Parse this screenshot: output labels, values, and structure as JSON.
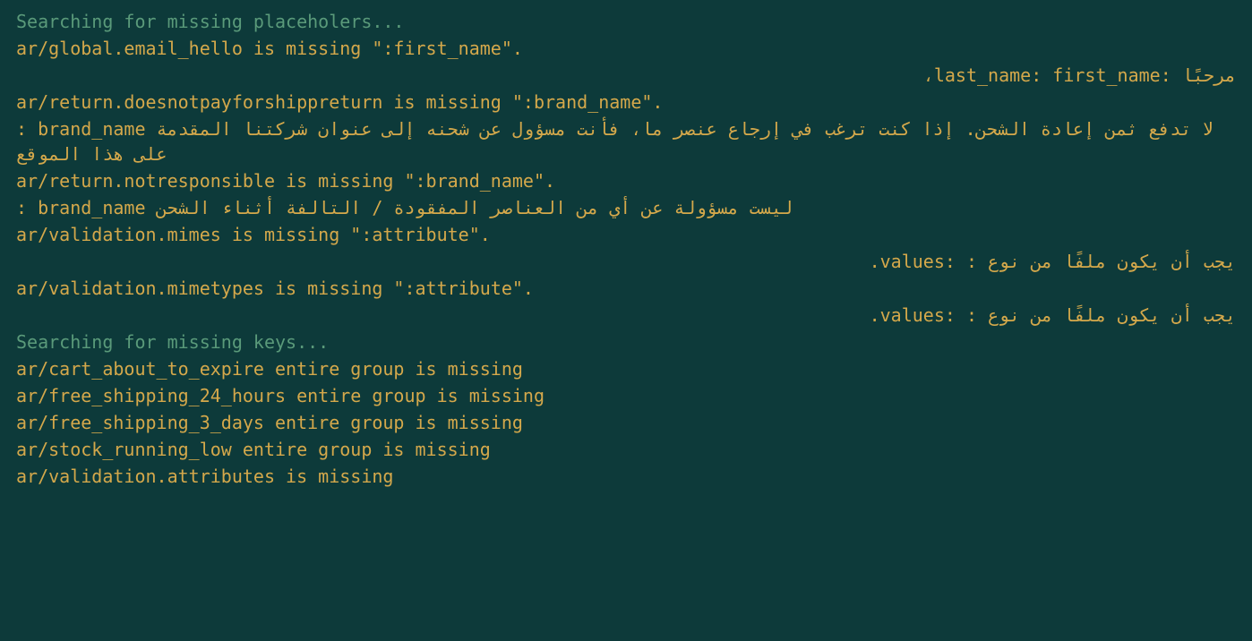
{
  "terminal": {
    "lines": [
      {
        "type": "status",
        "text": "Searching for missing placeholers..."
      },
      {
        "type": "warning",
        "text": "ar/global.email_hello is missing \":first_name\"."
      },
      {
        "type": "warning",
        "mixed": true,
        "text": "مرحبًا :last_name: first_name،"
      },
      {
        "type": "warning",
        "text": "ar/return.doesnotpayforshippreturn is missing \":brand_name\"."
      },
      {
        "type": "warning",
        "mixed": true,
        "text": ": brand_name لا تدفع ثمن إعادة الشحن. إذا كنت ترغب في إرجاع عنصر ما، فأنت مسؤول عن شحنه إلى عنوان شركتنا المقدمة على هذا الموقع"
      },
      {
        "type": "warning",
        "text": "ar/return.notresponsible is missing \":brand_name\"."
      },
      {
        "type": "warning",
        "mixed": true,
        "text": ": brand_name ليست مسؤولة عن أي من العناصر المفقودة / التالفة أثناء الشحن"
      },
      {
        "type": "warning",
        "text": "ar/validation.mimes is missing \":attribute\"."
      },
      {
        "type": "warning",
        "mixed": true,
        "text": "يجب أن يكون ملفًا من نوع : :values."
      },
      {
        "type": "warning",
        "text": "ar/validation.mimetypes is missing \":attribute\"."
      },
      {
        "type": "warning",
        "mixed": true,
        "text": "يجب أن يكون ملفًا من نوع : :values."
      },
      {
        "type": "status",
        "text": "Searching for missing keys..."
      },
      {
        "type": "warning",
        "text": "ar/cart_about_to_expire entire group is missing"
      },
      {
        "type": "warning",
        "text": "ar/free_shipping_24_hours entire group is missing"
      },
      {
        "type": "warning",
        "text": "ar/free_shipping_3_days entire group is missing"
      },
      {
        "type": "warning",
        "text": "ar/stock_running_low entire group is missing"
      },
      {
        "type": "warning",
        "text": "ar/validation.attributes is missing"
      }
    ]
  }
}
